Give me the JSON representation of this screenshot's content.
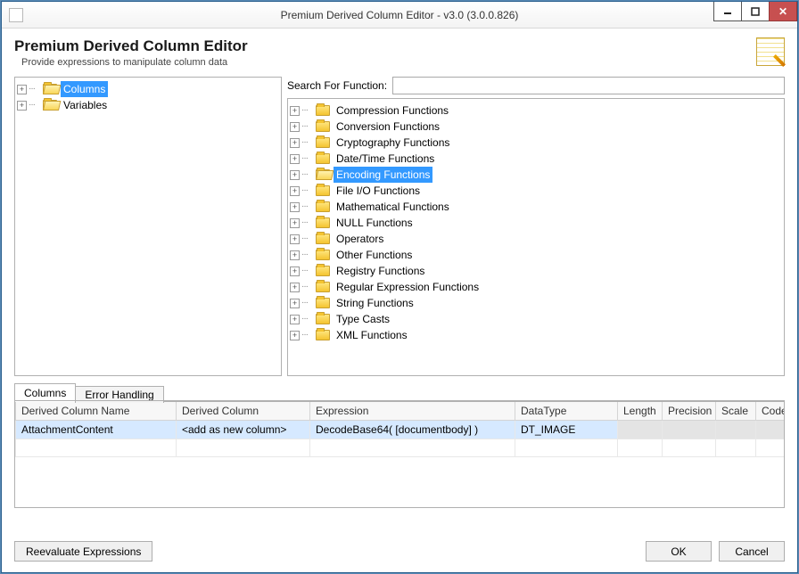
{
  "window": {
    "title": "Premium Derived Column Editor - v3.0 (3.0.0.826)"
  },
  "header": {
    "title": "Premium Derived Column Editor",
    "subtitle": "Provide expressions to manipulate column data"
  },
  "leftTree": {
    "items": [
      {
        "label": "Columns",
        "selected": true,
        "open": true
      },
      {
        "label": "Variables",
        "selected": false,
        "open": true
      }
    ]
  },
  "search": {
    "label": "Search For Function:",
    "value": ""
  },
  "functions": [
    {
      "label": "Compression Functions",
      "selected": false
    },
    {
      "label": "Conversion Functions",
      "selected": false
    },
    {
      "label": "Cryptography Functions",
      "selected": false
    },
    {
      "label": "Date/Time Functions",
      "selected": false
    },
    {
      "label": "Encoding Functions",
      "selected": true
    },
    {
      "label": "File I/O Functions",
      "selected": false
    },
    {
      "label": "Mathematical Functions",
      "selected": false
    },
    {
      "label": "NULL Functions",
      "selected": false
    },
    {
      "label": "Operators",
      "selected": false
    },
    {
      "label": "Other Functions",
      "selected": false
    },
    {
      "label": "Registry Functions",
      "selected": false
    },
    {
      "label": "Regular Expression Functions",
      "selected": false
    },
    {
      "label": "String Functions",
      "selected": false
    },
    {
      "label": "Type Casts",
      "selected": false
    },
    {
      "label": "XML Functions",
      "selected": false
    }
  ],
  "tabs": {
    "active": "Columns",
    "inactive": "Error Handling"
  },
  "grid": {
    "headers": {
      "name": "Derived Column Name",
      "derived": "Derived Column",
      "expr": "Expression",
      "dtype": "DataType",
      "len": "Length",
      "prec": "Precision",
      "scale": "Scale",
      "cp": "CodePage"
    },
    "row": {
      "name": "AttachmentContent",
      "derived": "<add as new column>",
      "expr": "DecodeBase64( [documentbody] )",
      "dtype": "DT_IMAGE",
      "len": "",
      "prec": "",
      "scale": "",
      "cp": ""
    }
  },
  "buttons": {
    "reeval": "Reevaluate Expressions",
    "ok": "OK",
    "cancel": "Cancel"
  }
}
